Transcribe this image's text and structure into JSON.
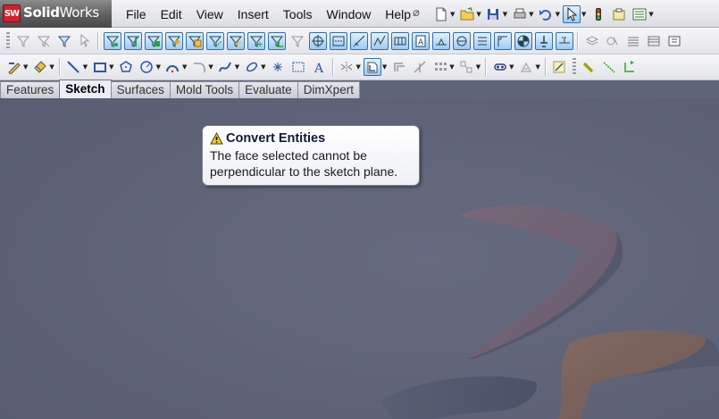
{
  "app": {
    "logo_badge": "SW",
    "name_bold": "Solid",
    "name_rest": "Works"
  },
  "menu": {
    "items": [
      "File",
      "Edit",
      "View",
      "Insert",
      "Tools",
      "Window",
      "Help"
    ]
  },
  "command_manager": {
    "tabs": [
      {
        "label": "Features",
        "active": false
      },
      {
        "label": "Sketch",
        "active": true
      },
      {
        "label": "Surfaces",
        "active": false
      },
      {
        "label": "Mold Tools",
        "active": false
      },
      {
        "label": "Evaluate",
        "active": false
      },
      {
        "label": "DimXpert",
        "active": false
      }
    ]
  },
  "tooltip": {
    "title": "Convert Entities",
    "message_line1": "The face selected cannot be",
    "message_line2": "perpendicular to the sketch plane.",
    "icon": "warning-icon"
  },
  "colors": {
    "viewport": "#5f6579",
    "highlight": "#9fcaf4",
    "logo_red": "#d4202a"
  }
}
